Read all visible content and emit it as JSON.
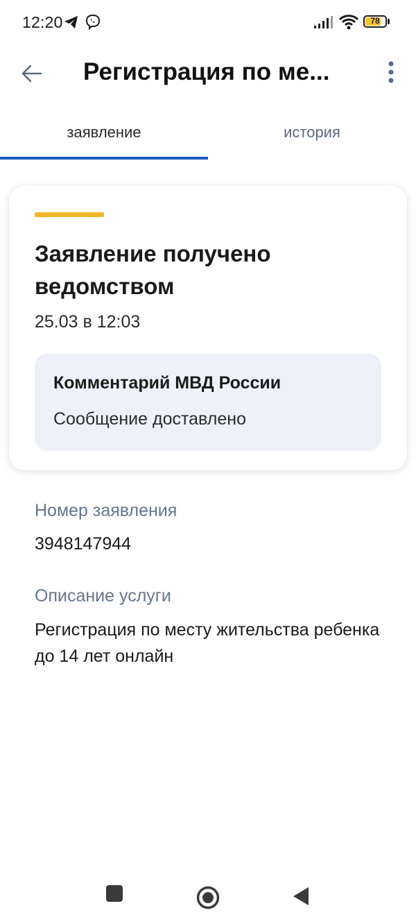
{
  "status_bar": {
    "time": "12:20",
    "battery_level": "78",
    "battery_fraction": 0.78
  },
  "app_bar": {
    "title": "Регистрация по ме...",
    "back_icon": "arrow-left-icon",
    "more_icon": "more-vertical-icon"
  },
  "tabs": [
    {
      "label": "заявление",
      "active": true
    },
    {
      "label": "история",
      "active": false
    }
  ],
  "status_card": {
    "accent_color": "#f4b82a",
    "title": "Заявление получено ведомством",
    "date": "25.03 в 12:03",
    "comment": {
      "title": "Комментарий МВД России",
      "text": "Сообщение доставлено"
    }
  },
  "details": {
    "application_number_label": "Номер заявления",
    "application_number": "3948147944",
    "service_description_label": "Описание услуги",
    "service_description": "Регистрация по месту жительства ребенка до 14 лет онлайн"
  },
  "colors": {
    "tab_indicator": "#1d5bbf",
    "comment_background": "#eef2f8",
    "label": "#66768e"
  }
}
